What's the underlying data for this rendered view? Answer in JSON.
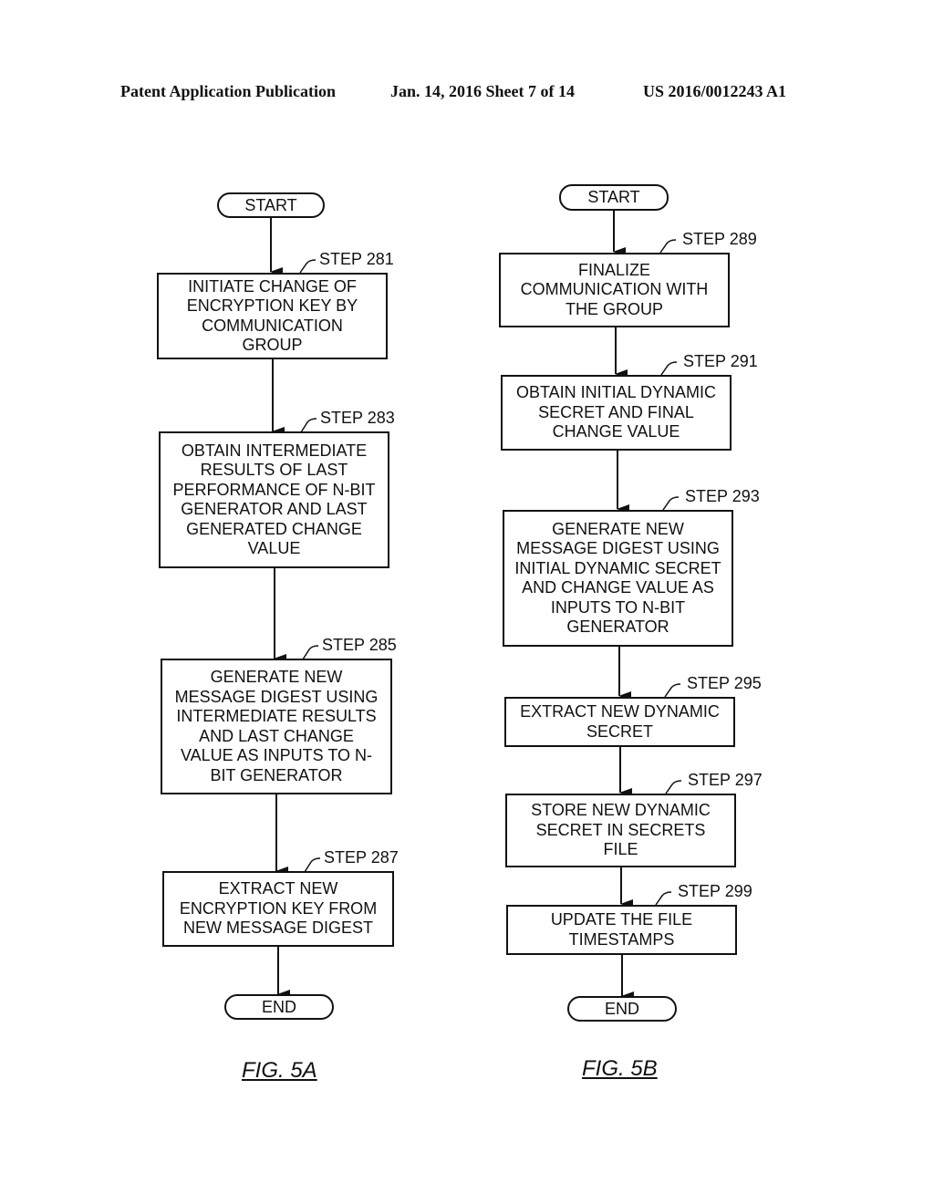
{
  "header": {
    "publication": "Patent Application Publication",
    "date_sheet": "Jan. 14, 2016  Sheet 7 of 14",
    "number": "US 2016/0012243 A1"
  },
  "fig5a": {
    "caption": "FIG. 5A",
    "start": "START",
    "end": "END",
    "steps": [
      {
        "label": "STEP 281",
        "text": "INITIATE CHANGE OF\nENCRYPTION KEY BY\nCOMMUNICATION\nGROUP"
      },
      {
        "label": "STEP 283",
        "text": "OBTAIN INTERMEDIATE\nRESULTS OF LAST\nPERFORMANCE OF N-BIT\nGENERATOR AND LAST\nGENERATED CHANGE\nVALUE"
      },
      {
        "label": "STEP 285",
        "text": "GENERATE NEW\nMESSAGE DIGEST USING\nINTERMEDIATE RESULTS\nAND LAST CHANGE\nVALUE AS INPUTS TO N-\nBIT GENERATOR"
      },
      {
        "label": "STEP 287",
        "text": "EXTRACT NEW\nENCRYPTION KEY FROM\nNEW MESSAGE DIGEST"
      }
    ]
  },
  "fig5b": {
    "caption": "FIG. 5B",
    "start": "START",
    "end": "END",
    "steps": [
      {
        "label": "STEP 289",
        "text": "FINALIZE\nCOMMUNICATION WITH\nTHE GROUP"
      },
      {
        "label": "STEP 291",
        "text": "OBTAIN INITIAL DYNAMIC\nSECRET AND FINAL\nCHANGE VALUE"
      },
      {
        "label": "STEP 293",
        "text": "GENERATE NEW\nMESSAGE DIGEST USING\nINITIAL DYNAMIC SECRET\nAND CHANGE VALUE AS\nINPUTS TO N-BIT\nGENERATOR"
      },
      {
        "label": "STEP 295",
        "text": "EXTRACT NEW DYNAMIC\nSECRET"
      },
      {
        "label": "STEP 297",
        "text": "STORE NEW DYNAMIC\nSECRET IN SECRETS\nFILE"
      },
      {
        "label": "STEP 299",
        "text": "UPDATE THE FILE\nTIMESTAMPS"
      }
    ]
  }
}
